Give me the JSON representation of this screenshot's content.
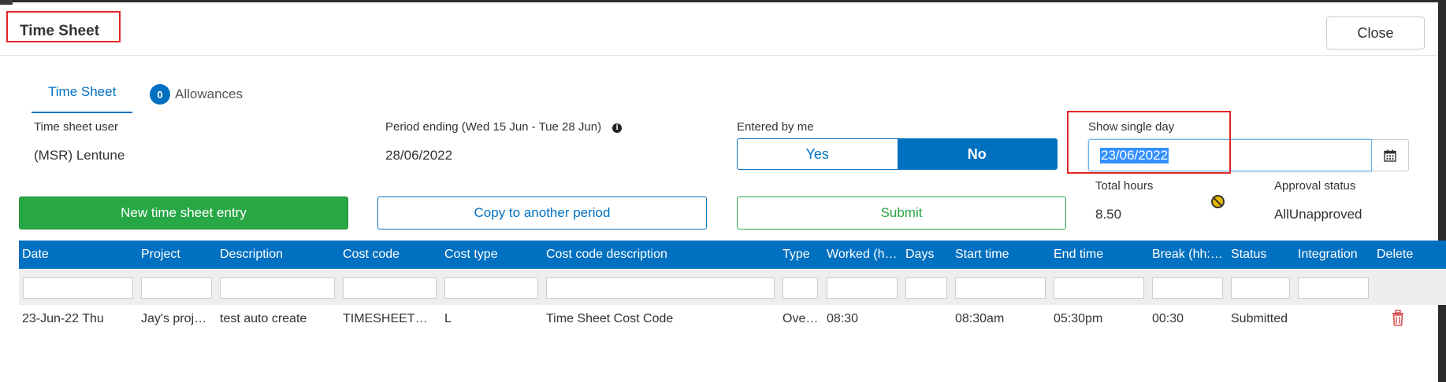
{
  "window": {
    "title": "Time Sheet",
    "close_label": "Close"
  },
  "tabs": [
    {
      "label": "Time Sheet",
      "active": true
    },
    {
      "label": "Allowances",
      "badge": "0",
      "active": false
    }
  ],
  "form": {
    "user_label": "Time sheet user",
    "user_value": "(MSR) Lentune",
    "period_label": "Period ending (Wed 15 Jun - Tue 28 Jun)",
    "period_value": "28/06/2022",
    "entered_label": "Entered by me",
    "entered_options": [
      "Yes",
      "No"
    ],
    "entered_selected": "No",
    "single_day_label": "Show single day",
    "single_day_value": "23/06/2022",
    "total_hours_label": "Total hours",
    "total_hours_value": "8.50",
    "approval_label": "Approval status",
    "approval_value": "AllUnapproved"
  },
  "actions": {
    "new_entry": "New time sheet entry",
    "copy_period": "Copy to another period",
    "submit": "Submit"
  },
  "grid": {
    "columns": [
      "Date",
      "Project",
      "Description",
      "Cost code",
      "Cost type",
      "Cost code description",
      "Type",
      "Worked (hh:mm)",
      "Days",
      "Start time",
      "End time",
      "Break (hh:mm)",
      "Status",
      "Integration",
      "Delete"
    ],
    "rows": [
      {
        "date": "23-Jun-22 Thu",
        "project": "Jay's project",
        "description": "test auto create",
        "cost_code": "TIMESHEETCODE",
        "cost_type": "L",
        "cost_code_description": "Time Sheet Cost Code",
        "type": "Overtime",
        "worked": "08:30",
        "days": "",
        "start_time": "08:30am",
        "end_time": "05:30pm",
        "break": "00:30",
        "status": "Submitted",
        "integration": ""
      }
    ]
  },
  "colors": {
    "accent": "#0070c0",
    "success": "#28a745",
    "highlight": "#e32626",
    "danger": "#d9534f"
  },
  "icons": {
    "info": "info-circle-icon",
    "calendar": "calendar-icon",
    "approval": "ban-icon",
    "delete": "trash-icon"
  }
}
